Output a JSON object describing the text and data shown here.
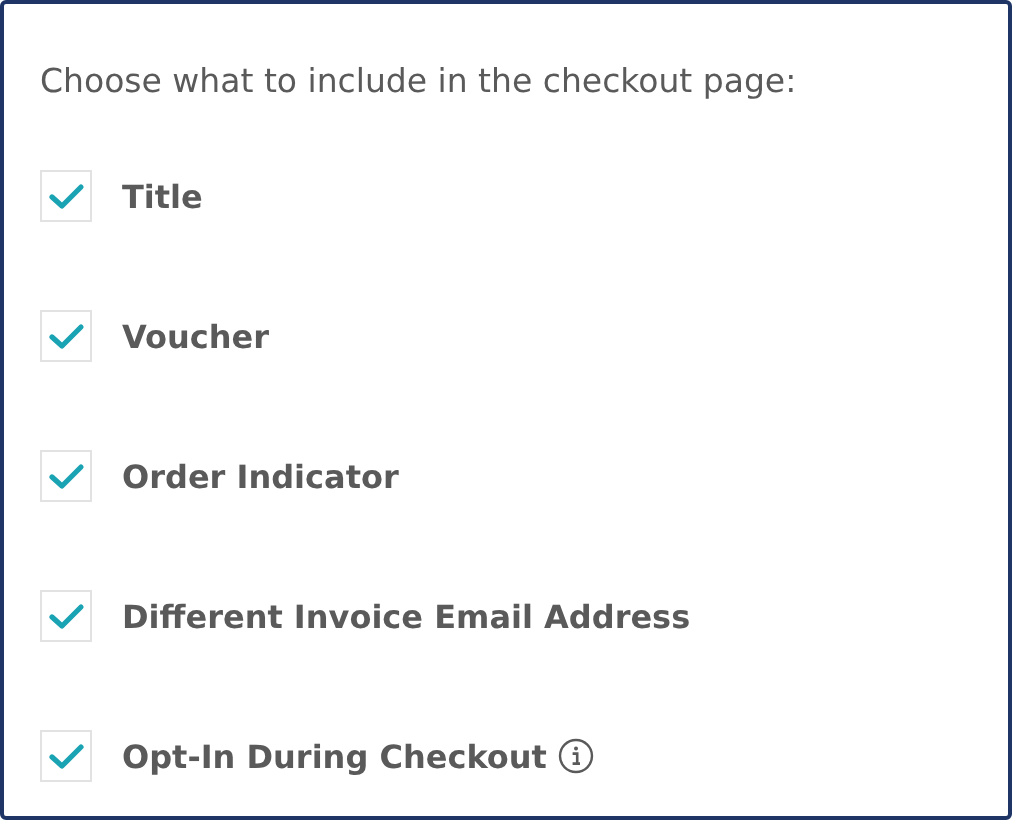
{
  "heading": "Choose what to include in the checkout page:",
  "options": [
    {
      "label": "Title",
      "checked": true,
      "info": false
    },
    {
      "label": "Voucher",
      "checked": true,
      "info": false
    },
    {
      "label": "Order Indicator",
      "checked": true,
      "info": false
    },
    {
      "label": "Different Invoice Email Address",
      "checked": true,
      "info": false
    },
    {
      "label": "Opt-In During Checkout",
      "checked": true,
      "info": true
    }
  ]
}
